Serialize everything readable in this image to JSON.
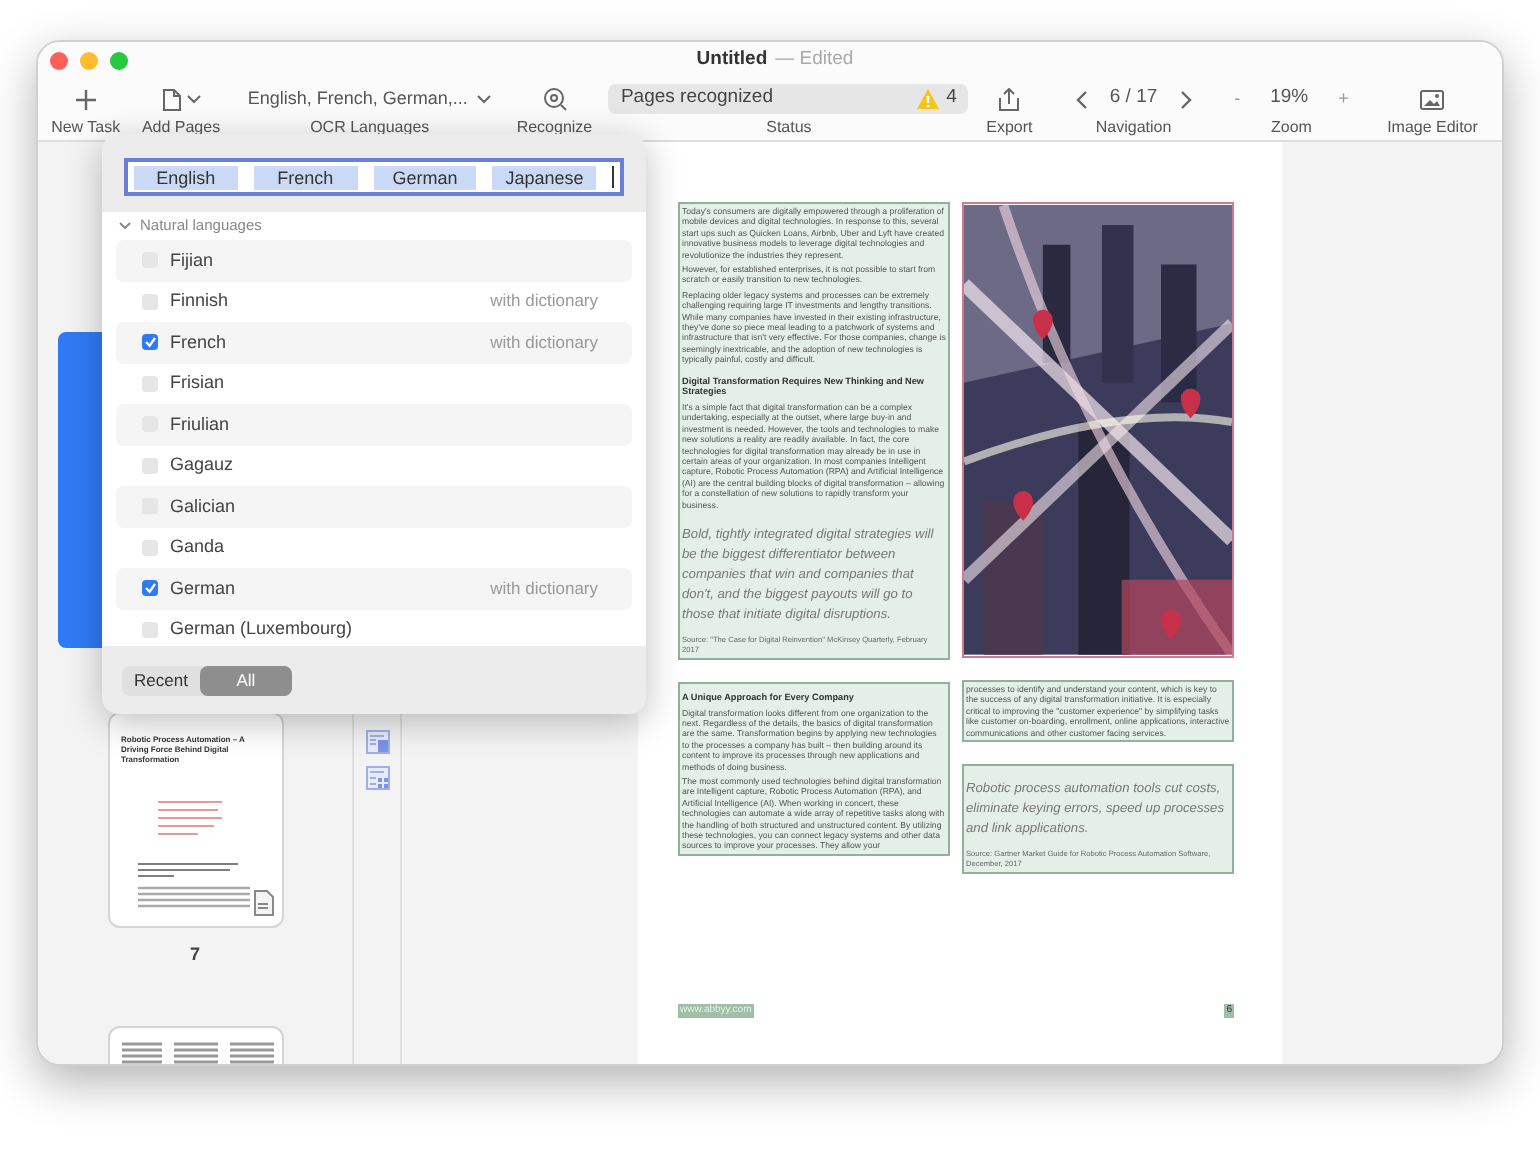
{
  "window": {
    "title": "Untitled",
    "subtitle": "— Edited"
  },
  "toolbar": {
    "new_task": {
      "label": "New Task"
    },
    "add_pages": {
      "label": "Add Pages"
    },
    "ocr_languages": {
      "value": "English, French, German,...",
      "label": "OCR Languages"
    },
    "recognize": {
      "label": "Recognize"
    },
    "status": {
      "value": "Pages recognized",
      "warnings": "4",
      "label": "Status"
    },
    "export": {
      "label": "Export"
    },
    "navigation": {
      "page": "6 / 17",
      "label": "Navigation"
    },
    "zoom": {
      "minus": "-",
      "value": "19%",
      "plus": "+",
      "label": "Zoom"
    },
    "image_editor": {
      "label": "Image Editor"
    }
  },
  "language_popover": {
    "tokens": [
      "English",
      "French",
      "German",
      "Japanese"
    ],
    "section": {
      "title": "Natural languages",
      "expanded": true
    },
    "languages": [
      {
        "name": "Fijian",
        "checked": false
      },
      {
        "name": "Finnish",
        "checked": false,
        "note": "with dictionary"
      },
      {
        "name": "French",
        "checked": true,
        "note": "with dictionary"
      },
      {
        "name": "Frisian",
        "checked": false
      },
      {
        "name": "Friulian",
        "checked": false
      },
      {
        "name": "Gagauz",
        "checked": false
      },
      {
        "name": "Galician",
        "checked": false
      },
      {
        "name": "Ganda",
        "checked": false
      },
      {
        "name": "German",
        "checked": true,
        "note": "with dictionary"
      },
      {
        "name": "German (Luxembourg)",
        "checked": false
      }
    ],
    "filters": [
      {
        "label": "Recent",
        "selected": false
      },
      {
        "label": "All",
        "selected": true
      }
    ]
  },
  "sidebar": {
    "thumbnails": [
      {
        "selected": true
      },
      {
        "selected": false,
        "title": "Robotic Process Automation – A Driving Force Behind Digital Transformation",
        "number": "7"
      },
      {
        "selected": false
      }
    ]
  },
  "document": {
    "left_column": [
      {
        "parts": [
          {
            "kind": "para",
            "text": "Today's consumers are digitally empowered through a proliferation of mobile devices and digital technologies. In response to this, several start ups such as Quicken Loans, Airbnb, Uber and Lyft have created innovative business models to leverage digital technologies and revolutionize the industries they represent."
          },
          {
            "kind": "para",
            "text": "However, for established enterprises, it is not possible to start from scratch or easily transition to new technologies."
          },
          {
            "kind": "para",
            "text": "Replacing older legacy systems and processes can be extremely challenging requiring large IT investments and lengthy transitions. While many companies have invested in their existing infrastructure, they've done so piece meal leading to a patchwork of systems and infrastructure that isn't very effective. For those companies, change is seemingly inextricable, and the adoption of new technologies is typically painful, costly and difficult."
          },
          {
            "kind": "heading",
            "text": "Digital Transformation Requires New Thinking and New Strategies"
          },
          {
            "kind": "para",
            "text": "It's a simple fact that digital transformation can be a complex undertaking, especially at the outset, where large buy-in and investment is needed. However, the tools and technologies to make new solutions a reality are readily available. In fact, the core technologies for digital transformation may already be in use in certain areas of your organization. In most companies Intelligent capture, Robotic Process Automation (RPA) and Artificial Intelligence (AI) are the central building blocks of digital transformation – allowing for a constellation of new solutions to rapidly transform your business."
          },
          {
            "kind": "quote",
            "text": "Bold, tightly integrated digital strategies will be the biggest differentiator between companies that win and companies that don't, and the biggest payouts will go to those that initiate digital disruptions."
          },
          {
            "kind": "source",
            "text": "Source: \"The Case for Digital Reinvention\" McKinsey Quarterly, February 2017"
          }
        ]
      },
      {
        "parts": [
          {
            "kind": "heading",
            "text": "A Unique Approach for Every Company"
          },
          {
            "kind": "para",
            "text": "Digital transformation looks different from one organization to the next. Regardless of the details, the basics of digital transformation are the same. Transformation begins by applying new technologies to the processes a company has built – then building around its content to improve its processes through new applications and methods of doing business."
          },
          {
            "kind": "para",
            "text": "The most commonly used technologies behind digital transformation are Intelligent capture, Robotic Process Automation (RPA), and Artificial Intelligence (AI). When working in concert, these technologies can automate a wide array of repetitive tasks along with the handling of both structured and unstructured content. By utilizing these technologies, you can connect legacy systems and other data sources to improve your processes. They allow your"
          }
        ]
      }
    ],
    "right_column": [
      {
        "kind": "picture"
      },
      {
        "parts": [
          {
            "kind": "para",
            "text": "processes to identify and understand your content, which is key to the success of any digital transformation initiative. It is especially critical to improving the \"customer experience\" by simplifying tasks like customer on-boarding, enrollment, online applications, interactive communications and other customer facing services."
          }
        ]
      },
      {
        "parts": [
          {
            "kind": "quote",
            "text": "Robotic process automation tools cut costs, eliminate keying errors, speed up processes and link applications."
          },
          {
            "kind": "source",
            "text": "Source: Gartner Market Guide for Robotic Process Automation Software, December, 2017"
          }
        ]
      }
    ],
    "footer": {
      "website": "www.abbyy.com",
      "page_number": "6"
    }
  }
}
